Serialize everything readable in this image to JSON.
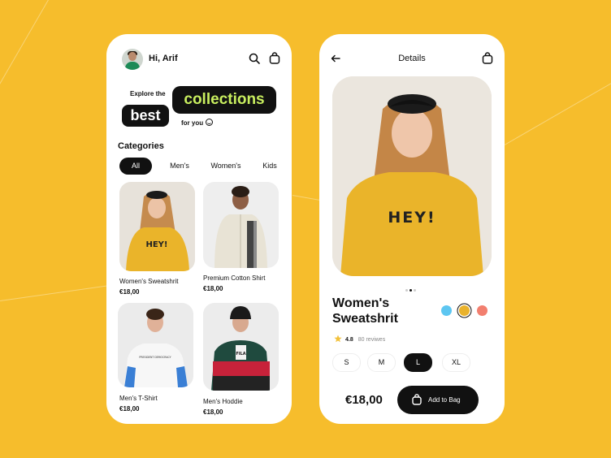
{
  "colors": {
    "background": "#f6bd2c",
    "accent_text": "#c9ef5f",
    "dark": "#111111"
  },
  "home": {
    "greeting": "Hi, Arif",
    "banner": {
      "explore": "Explore the",
      "best": "best",
      "collections": "collections",
      "for_you": "for you"
    },
    "categories_title": "Categories",
    "tabs": [
      {
        "label": "All",
        "active": true
      },
      {
        "label": "Men's"
      },
      {
        "label": "Women's"
      },
      {
        "label": "Kids"
      }
    ],
    "products": [
      {
        "name": "Women's Sweatshrit",
        "price": "€18,00"
      },
      {
        "name": "Premium Cotton Shirt",
        "price": "€18,00"
      },
      {
        "name": "Men's T-Shirt",
        "price": "€18,00"
      },
      {
        "name": "Men's Hoddie",
        "price": "€18,00"
      }
    ],
    "shirt_text": "HEY!",
    "tshirt_text": "PRESIDENT DEMOCRACY",
    "hoodie_text": "FILA"
  },
  "detail": {
    "title": "Details",
    "product_name": "Women's Sweatshrit",
    "shirt_text": "HEY!",
    "colors": [
      {
        "hex": "#5dc6f1"
      },
      {
        "hex": "#e9b22c",
        "selected": true
      },
      {
        "hex": "#f27f6f"
      }
    ],
    "rating": "4.8",
    "reviews": "80 reviwes",
    "sizes": [
      {
        "label": "S"
      },
      {
        "label": "M"
      },
      {
        "label": "L",
        "selected": true
      },
      {
        "label": "XL"
      }
    ],
    "carousel": {
      "count": 3,
      "active": 2
    },
    "price": "€18,00",
    "add_button": "Add to Bag"
  }
}
